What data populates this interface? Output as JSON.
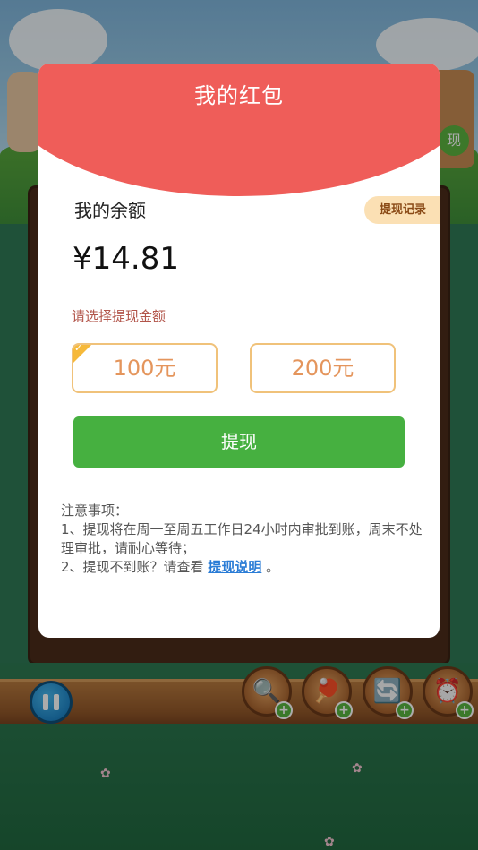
{
  "modal": {
    "title": "我的红包",
    "balance_label": "我的余额",
    "record_button": "提现记录",
    "balance_value": "¥14.81",
    "select_label": "请选择提现金额",
    "amount_options": [
      {
        "label": "100元",
        "selected": true
      },
      {
        "label": "200元",
        "selected": false
      }
    ],
    "withdraw_button": "提现",
    "notes": {
      "title": "注意事项：",
      "line1": "1、提现将在周一至周五工作日24小时内审批到账，周末不处理审批，请耐心等待；",
      "line2_prefix": "2、提现不到账？请查看 ",
      "line2_link": "提现说明",
      "line2_suffix": " 。"
    }
  },
  "background": {
    "side_tab_label": "现",
    "tools": [
      {
        "icon": "magnifier-icon",
        "glyph": "🔍"
      },
      {
        "icon": "ping-pong-icon",
        "glyph": "🏓"
      },
      {
        "icon": "refresh-icon",
        "glyph": "🔄"
      },
      {
        "icon": "clock-icon",
        "glyph": "⏰"
      }
    ],
    "tool_plus": "+"
  },
  "colors": {
    "header_red": "#ef5d59",
    "button_green": "#46b040",
    "option_border": "#f0c27a",
    "option_text": "#e4955c",
    "link_blue": "#2a7cd6"
  }
}
